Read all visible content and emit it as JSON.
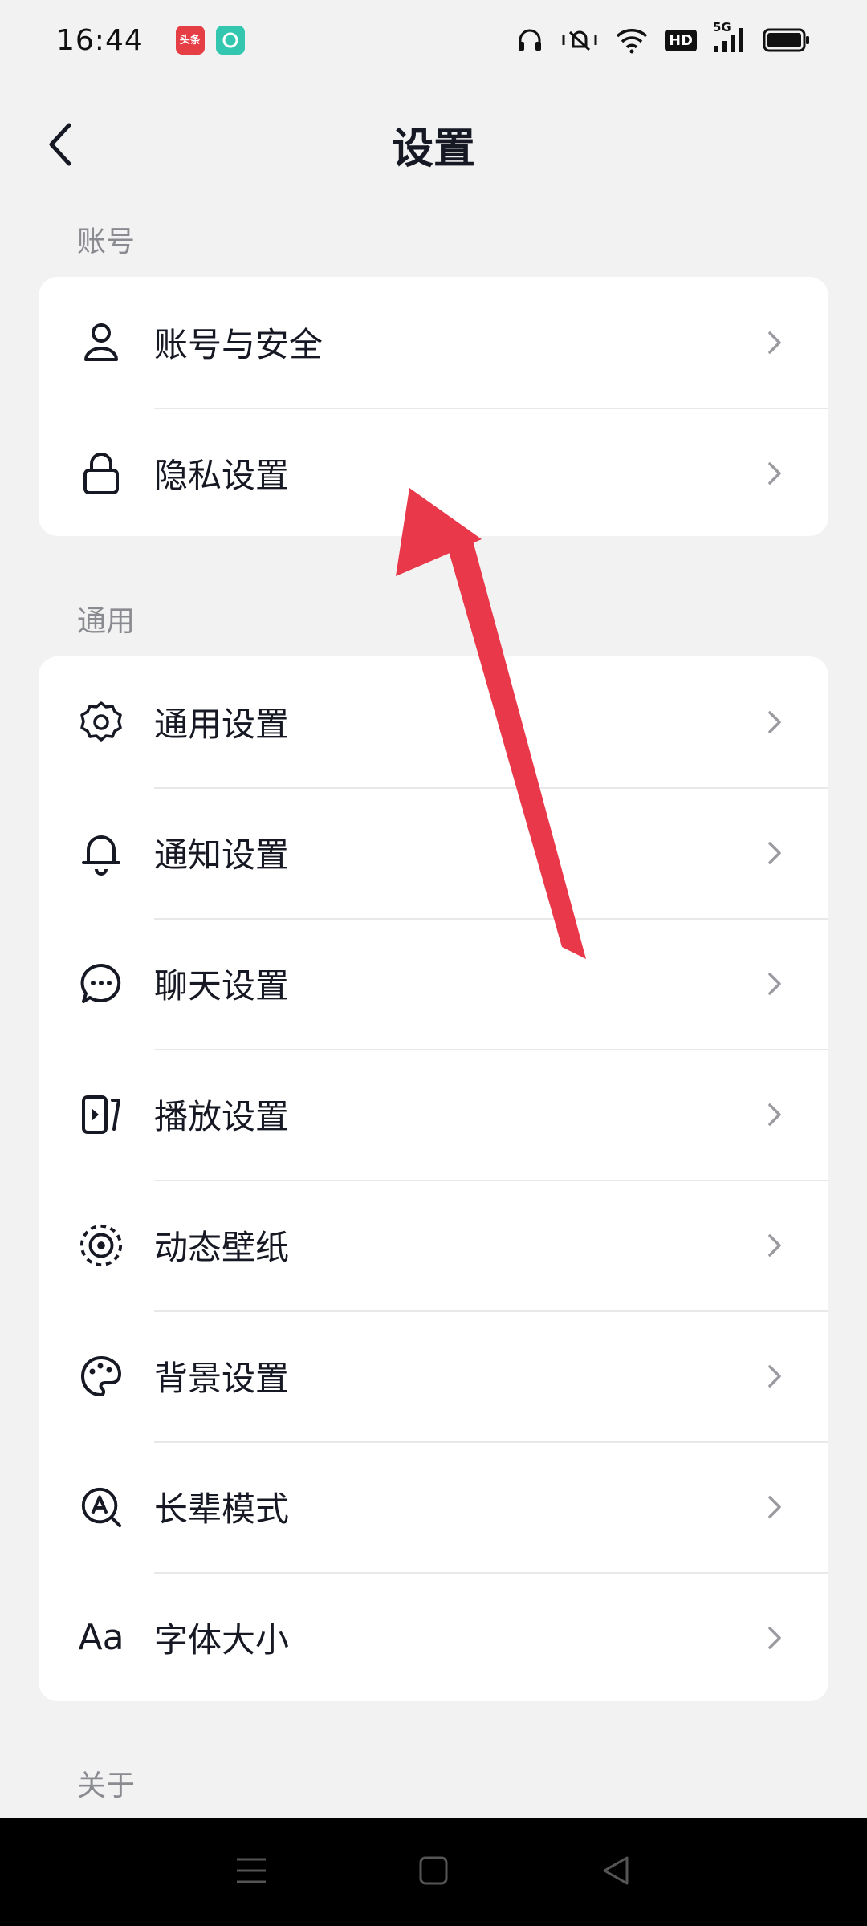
{
  "status_bar": {
    "time": "16:44",
    "app_badge_text": "头条",
    "network": "5G",
    "hd": "HD"
  },
  "header": {
    "title": "设置"
  },
  "sections": {
    "account": {
      "label": "账号",
      "items": [
        {
          "label": "账号与安全",
          "icon": "user-icon"
        },
        {
          "label": "隐私设置",
          "icon": "lock-icon"
        }
      ]
    },
    "general": {
      "label": "通用",
      "items": [
        {
          "label": "通用设置",
          "icon": "gear-icon"
        },
        {
          "label": "通知设置",
          "icon": "bell-icon"
        },
        {
          "label": "聊天设置",
          "icon": "chat-bubble-icon"
        },
        {
          "label": "播放设置",
          "icon": "play-icon"
        },
        {
          "label": "动态壁纸",
          "icon": "wallpaper-icon"
        },
        {
          "label": "背景设置",
          "icon": "palette-icon"
        },
        {
          "label": "长辈模式",
          "icon": "elder-mode-icon"
        },
        {
          "label": "字体大小",
          "icon": "font-size-icon",
          "icon_text": "Aa"
        }
      ]
    },
    "about": {
      "label": "关于"
    }
  },
  "colors": {
    "background": "#f2f2f2",
    "card": "#ffffff",
    "text": "#161823",
    "secondary_text": "#8a8b91",
    "annotation_arrow": "#e8384a"
  }
}
